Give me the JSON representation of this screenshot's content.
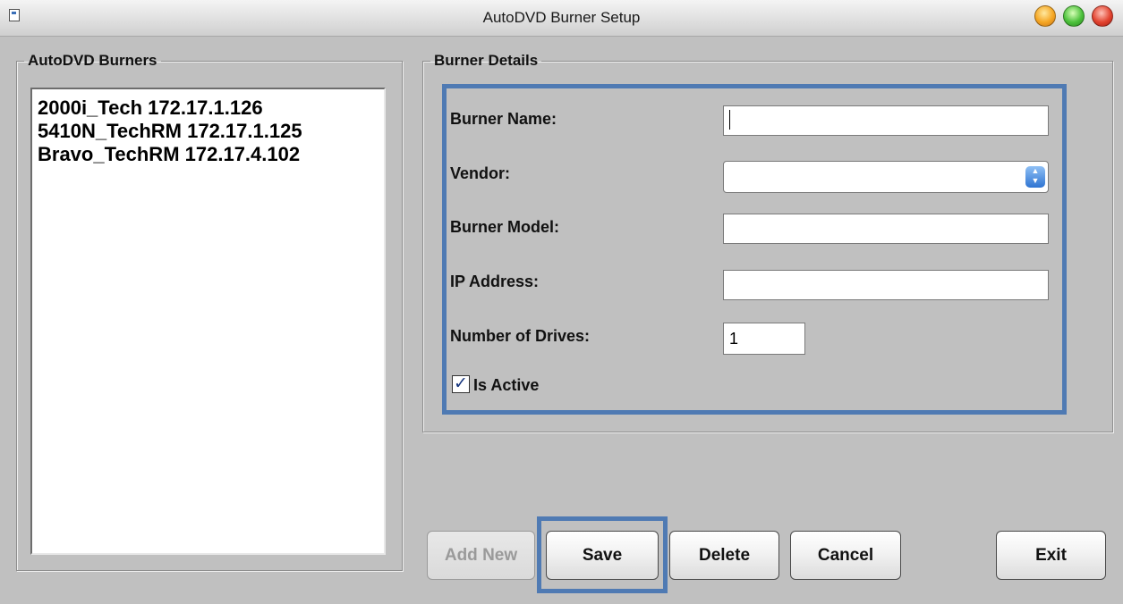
{
  "window": {
    "title": "AutoDVD Burner Setup"
  },
  "burners": {
    "legend": "AutoDVD Burners",
    "items": [
      "2000i_Tech 172.17.1.126",
      "5410N_TechRM 172.17.1.125",
      "Bravo_TechRM 172.17.4.102"
    ]
  },
  "details": {
    "legend": "Burner Details",
    "burner_name_label": "Burner Name:",
    "burner_name_value": "",
    "vendor_label": "Vendor:",
    "vendor_value": "",
    "burner_model_label": "Burner Model:",
    "burner_model_value": "",
    "ip_address_label": "IP Address:",
    "ip_address_value": "",
    "drives_label": "Number of Drives:",
    "drives_value": "1",
    "is_active_label": "Is Active",
    "is_active_checked": true
  },
  "buttons": {
    "add_new": "Add New",
    "save": "Save",
    "delete": "Delete",
    "cancel": "Cancel",
    "exit": "Exit"
  },
  "colors": {
    "highlight": "#4f7ab3"
  }
}
